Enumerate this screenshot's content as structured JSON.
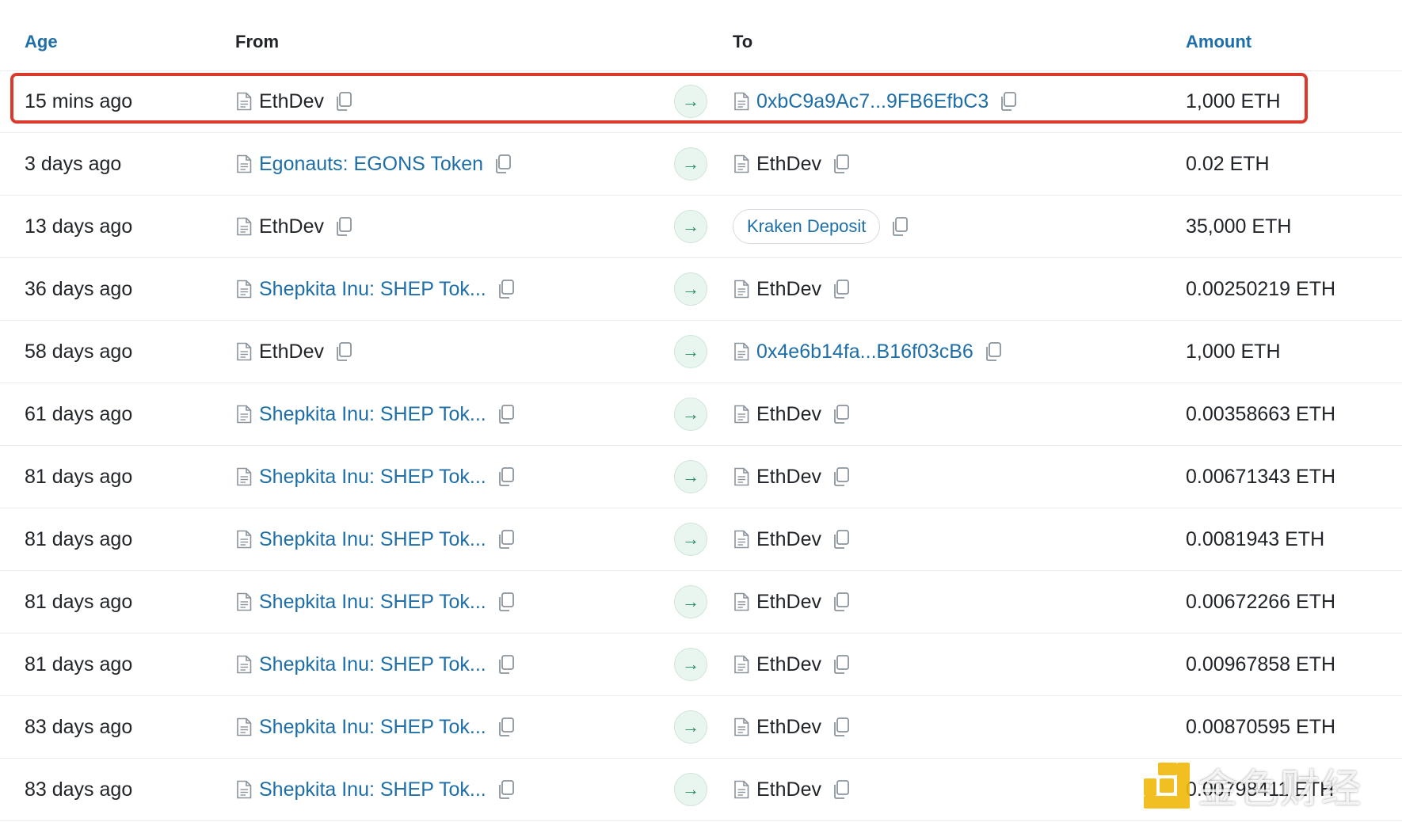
{
  "header": {
    "age": "Age",
    "from": "From",
    "to": "To",
    "amount": "Amount"
  },
  "rows": [
    {
      "age": "15 mins ago",
      "from": "EthDev",
      "from_link": false,
      "to": "0xbC9a9Ac7...9FB6EfbC3",
      "to_link": true,
      "to_type": "contract",
      "amount": "1,000 ETH"
    },
    {
      "age": "3 days ago",
      "from": "Egonauts: EGONS Token",
      "from_link": true,
      "to": "EthDev",
      "to_link": false,
      "to_type": "contract",
      "amount": "0.02 ETH"
    },
    {
      "age": "13 days ago",
      "from": "EthDev",
      "from_link": false,
      "to": "Kraken Deposit",
      "to_link": true,
      "to_type": "pill",
      "amount": "35,000 ETH"
    },
    {
      "age": "36 days ago",
      "from": "Shepkita Inu: SHEP Tok...",
      "from_link": true,
      "to": "EthDev",
      "to_link": false,
      "to_type": "contract",
      "amount": "0.00250219 ETH"
    },
    {
      "age": "58 days ago",
      "from": "EthDev",
      "from_link": false,
      "to": "0x4e6b14fa...B16f03cB6",
      "to_link": true,
      "to_type": "contract",
      "amount": "1,000 ETH"
    },
    {
      "age": "61 days ago",
      "from": "Shepkita Inu: SHEP Tok...",
      "from_link": true,
      "to": "EthDev",
      "to_link": false,
      "to_type": "contract",
      "amount": "0.00358663 ETH"
    },
    {
      "age": "81 days ago",
      "from": "Shepkita Inu: SHEP Tok...",
      "from_link": true,
      "to": "EthDev",
      "to_link": false,
      "to_type": "contract",
      "amount": "0.00671343 ETH"
    },
    {
      "age": "81 days ago",
      "from": "Shepkita Inu: SHEP Tok...",
      "from_link": true,
      "to": "EthDev",
      "to_link": false,
      "to_type": "contract",
      "amount": "0.0081943 ETH"
    },
    {
      "age": "81 days ago",
      "from": "Shepkita Inu: SHEP Tok...",
      "from_link": true,
      "to": "EthDev",
      "to_link": false,
      "to_type": "contract",
      "amount": "0.00672266 ETH"
    },
    {
      "age": "81 days ago",
      "from": "Shepkita Inu: SHEP Tok...",
      "from_link": true,
      "to": "EthDev",
      "to_link": false,
      "to_type": "contract",
      "amount": "0.00967858 ETH"
    },
    {
      "age": "83 days ago",
      "from": "Shepkita Inu: SHEP Tok...",
      "from_link": true,
      "to": "EthDev",
      "to_link": false,
      "to_type": "contract",
      "amount": "0.00870595 ETH"
    },
    {
      "age": "83 days ago",
      "from": "Shepkita Inu: SHEP Tok...",
      "from_link": true,
      "to": "EthDev",
      "to_link": false,
      "to_type": "contract",
      "amount": "0.00798411 ETH"
    }
  ],
  "arrow_glyph": "→",
  "watermark": {
    "text": "金色财经"
  },
  "colors": {
    "link": "#1e6ea7",
    "highlight": "#d93a2b",
    "arrow": "#1f8c5c",
    "arrow_bg": "#e9f5ef"
  },
  "icons": {
    "contract": "document-icon",
    "copy": "copy-icon",
    "direction": "arrow-right-icon"
  }
}
